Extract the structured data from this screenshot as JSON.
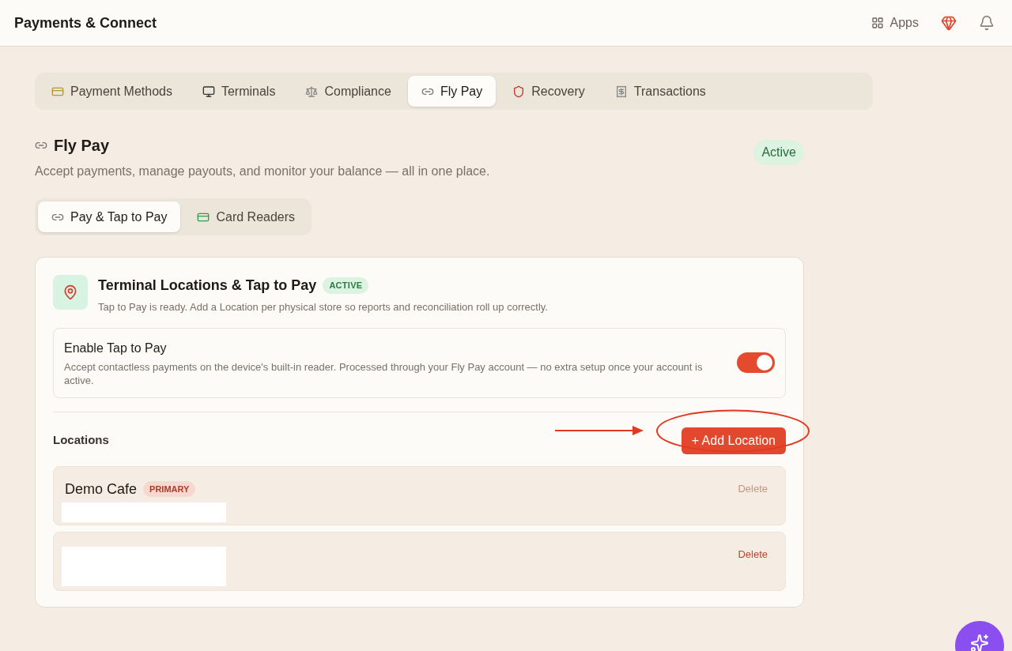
{
  "header": {
    "title": "Payments & Connect",
    "apps_label": "Apps"
  },
  "tabs": [
    {
      "label": "Payment Methods",
      "kind": "card",
      "selected": false
    },
    {
      "label": "Terminals",
      "kind": "monitor",
      "selected": false
    },
    {
      "label": "Compliance",
      "kind": "scales",
      "selected": false
    },
    {
      "label": "Fly Pay",
      "kind": "link",
      "selected": true
    },
    {
      "label": "Recovery",
      "kind": "shield",
      "selected": false
    },
    {
      "label": "Transactions",
      "kind": "receipt",
      "selected": false
    }
  ],
  "section": {
    "title": "Fly Pay",
    "description": "Accept payments, manage payouts, and monitor your balance — all in one place.",
    "status": "Active"
  },
  "subtabs": [
    {
      "label": "Pay & Tap to Pay",
      "kind": "link",
      "selected": true
    },
    {
      "label": "Card Readers",
      "kind": "reader",
      "selected": false
    }
  ],
  "card": {
    "title": "Terminal Locations & Tap to Pay",
    "badge": "ACTIVE",
    "subtitle": "Tap to Pay is ready. Add a Location per physical store so reports and reconciliation roll up correctly.",
    "toggle": {
      "label": "Enable Tap to Pay",
      "description": "Accept contactless payments on the device's built-in reader. Processed through your Fly Pay account — no extra setup once your account is active.",
      "on": true
    },
    "locations_label": "Locations",
    "add_button": "+ Add Location",
    "locations": [
      {
        "name": "Demo Cafe",
        "badge": "PRIMARY",
        "delete": "Delete",
        "disabled": true
      },
      {
        "delete": "Delete",
        "disabled": false
      }
    ]
  }
}
